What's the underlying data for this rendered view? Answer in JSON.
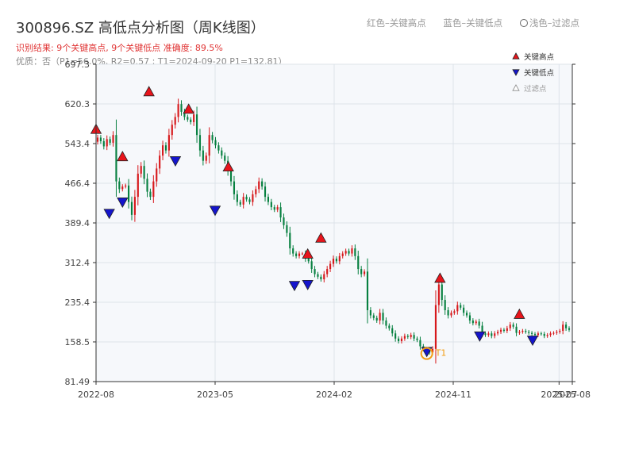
{
  "header": {
    "title": "300896.SZ 高低点分析图（周K线图）",
    "result_text": "识别结果: 9个关键高点, 9个关键低点   准确度: 89.5%",
    "quality_text": "优质：否（P1=56.0%, R2=0.57 ; T1=2024-09-20 P1=132.81）"
  },
  "top_legend": {
    "red_label": "红色–关键高点",
    "blue_label": "蓝色–关键低点",
    "light_label": "浅色–过滤点"
  },
  "colors": {
    "up": "#d7191c",
    "down": "#078040",
    "high_marker": "#e8141b",
    "low_marker": "#1515cc",
    "t1": "#f39c12",
    "grid": "#dde3ea",
    "plot_bg": "#f6f8fb"
  },
  "chart_data": {
    "type": "candlestick",
    "title": "300896.SZ 高低点分析图（周K线图）",
    "ylim": [
      81.49,
      697.3
    ],
    "y_ticks": [
      "81.49",
      "158.5",
      "235.4",
      "312.4",
      "389.4",
      "466.4",
      "543.4",
      "620.3",
      "697.3"
    ],
    "x_ticks": [
      "2022-08",
      "2023-05",
      "2024-02",
      "2024-11",
      "2025-07",
      "2025-08"
    ],
    "x_range": [
      "2022-08",
      "2025-08"
    ],
    "grid": true,
    "legend": {
      "position": "top-right",
      "items": [
        {
          "label": "关键高点",
          "marker": "triangle-up",
          "color": "#e8141b"
        },
        {
          "label": "关键低点",
          "marker": "triangle-down",
          "color": "#1515cc"
        },
        {
          "label": "过滤点",
          "marker": "triangle-up-light",
          "color": "#bbbbbb"
        }
      ]
    },
    "close": [
      555,
      548,
      538,
      552,
      545,
      560,
      470,
      455,
      460,
      462,
      430,
      405,
      440,
      485,
      500,
      475,
      450,
      440,
      470,
      495,
      520,
      540,
      530,
      560,
      580,
      595,
      620,
      605,
      595,
      590,
      585,
      600,
      560,
      530,
      510,
      520,
      560,
      550,
      540,
      530,
      520,
      510,
      490,
      470,
      445,
      430,
      425,
      440,
      435,
      430,
      445,
      455,
      470,
      460,
      440,
      430,
      420,
      415,
      420,
      400,
      385,
      370,
      340,
      330,
      325,
      330,
      330,
      320,
      315,
      300,
      290,
      285,
      280,
      290,
      300,
      310,
      320,
      315,
      325,
      330,
      335,
      330,
      340,
      325,
      300,
      290,
      295,
      220,
      210,
      205,
      200,
      215,
      200,
      190,
      185,
      175,
      165,
      160,
      165,
      170,
      168,
      172,
      165,
      162,
      150,
      145,
      142,
      138,
      145,
      230,
      270,
      240,
      220,
      210,
      215,
      218,
      230,
      225,
      215,
      210,
      200,
      195,
      198,
      190,
      175,
      172,
      175,
      170,
      175,
      178,
      182,
      180,
      185,
      192,
      188,
      176,
      178,
      180,
      178,
      176,
      174,
      172,
      175,
      174,
      170,
      172,
      175,
      176,
      178,
      180,
      192,
      185,
      182
    ],
    "key_highs": [
      {
        "date": "2022-08",
        "value": 571
      },
      {
        "date": "2022-10",
        "value": 518
      },
      {
        "date": "2022-12",
        "value": 644
      },
      {
        "date": "2023-03",
        "value": 610
      },
      {
        "date": "2023-06",
        "value": 498
      },
      {
        "date": "2023-12",
        "value": 329
      },
      {
        "date": "2024-01",
        "value": 360
      },
      {
        "date": "2024-10",
        "value": 282
      },
      {
        "date": "2025-04",
        "value": 212
      }
    ],
    "key_lows": [
      {
        "date": "2022-09",
        "value": 408
      },
      {
        "date": "2022-10",
        "value": 430
      },
      {
        "date": "2023-02",
        "value": 510
      },
      {
        "date": "2023-05",
        "value": 414
      },
      {
        "date": "2023-11",
        "value": 268
      },
      {
        "date": "2023-12",
        "value": 270
      },
      {
        "date": "2024-09",
        "value": 140
      },
      {
        "date": "2025-01",
        "value": 170
      },
      {
        "date": "2025-05",
        "value": 162
      }
    ],
    "t1": {
      "label": "T1",
      "date": "2024-09-20",
      "value": 132.81
    }
  }
}
